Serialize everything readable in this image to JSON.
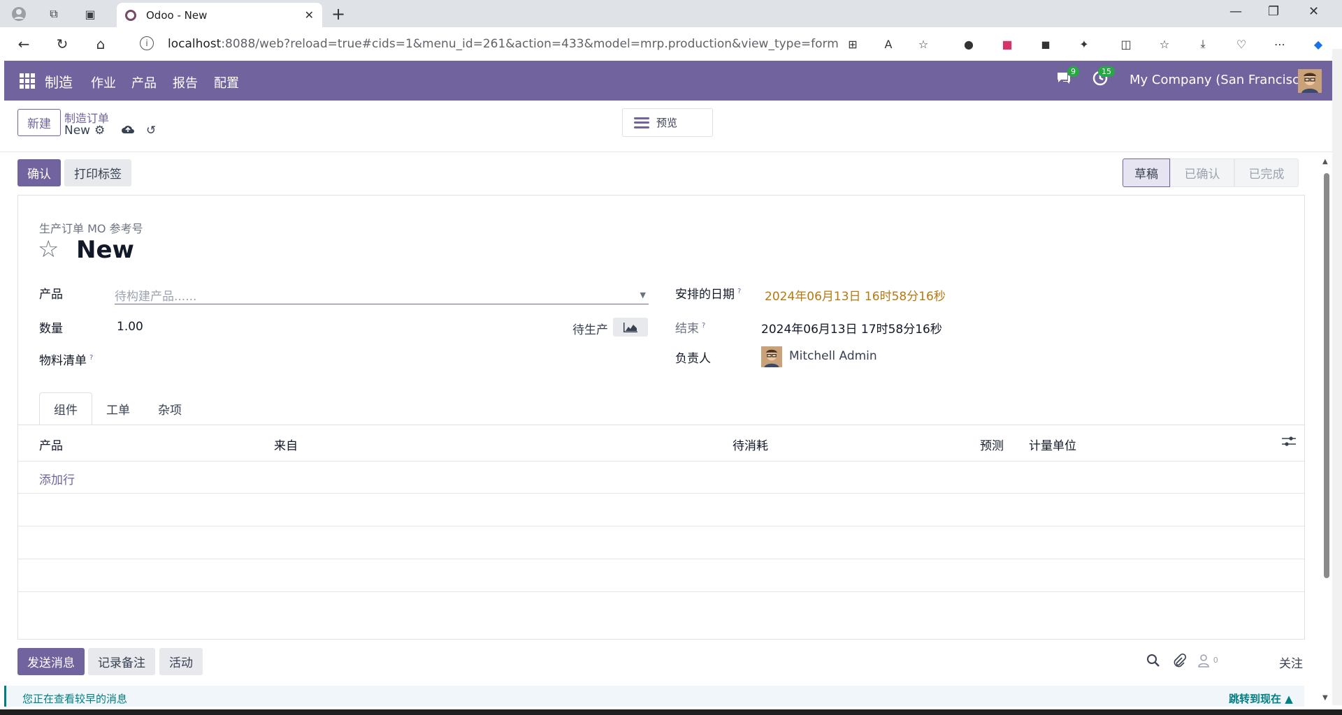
{
  "browser": {
    "tab_title": "Odoo - New",
    "url_host": "localhost",
    "url_rest": ":8088/web?reload=true#cids=1&menu_id=261&action=433&model=mrp.production&view_type=form"
  },
  "navbar": {
    "brand": "制造",
    "menus": [
      "作业",
      "产品",
      "报告",
      "配置"
    ],
    "messages_count": "9",
    "activities_count": "15",
    "company": "My Company (San Francisco)"
  },
  "control_panel": {
    "new_label": "新建",
    "breadcrumb_parent": "制造订单",
    "breadcrumb_current": "New",
    "preview_label": "预览"
  },
  "statusbar": {
    "confirm_label": "确认",
    "print_label": "打印标签",
    "stages": [
      "草稿",
      "已确认",
      "已完成"
    ]
  },
  "form": {
    "ref_label": "生产订单 MO 参考号",
    "title": "New",
    "product_label": "产品",
    "product_placeholder": "待构建产品......",
    "quantity_label": "数量",
    "quantity_value": "1.00",
    "to_produce_label": "待生产",
    "bom_label": "物料清单",
    "bom_help": "?",
    "scheduled_label": "安排的日期",
    "scheduled_help": "?",
    "scheduled_value": "2024年06月13日 16时58分16秒",
    "end_label": "结束",
    "end_help": "?",
    "end_value": "2024年06月13日 17时58分16秒",
    "responsible_label": "负责人",
    "responsible_value": "Mitchell Admin"
  },
  "tabs": [
    "组件",
    "工单",
    "杂项"
  ],
  "table": {
    "headers": [
      "产品",
      "来自",
      "待消耗",
      "预测",
      "计量单位"
    ],
    "add_line": "添加行"
  },
  "chatter": {
    "send_label": "发送消息",
    "note_label": "记录备注",
    "activity_label": "活动",
    "followers_count": "0",
    "follow_label": "关注",
    "older_msg": "您正在查看较早的消息",
    "jump_now": "跳转到现在"
  }
}
